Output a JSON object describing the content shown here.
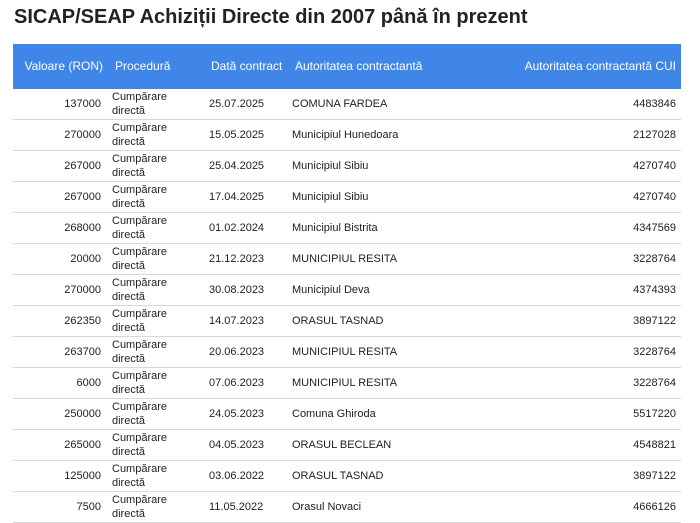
{
  "page": {
    "title": "SICAP/SEAP Achiziții Directe din 2007 până în prezent"
  },
  "table": {
    "headers": {
      "valoare": "Valoare (RON)",
      "procedura": "Procedură",
      "data": "Dată contract",
      "autoritatea": "Autoritatea contractantă",
      "cui": "Autoritatea contractantă CUI"
    },
    "rows": [
      {
        "valoare": "137000",
        "procedura": "Cumpărare directă",
        "data": "25.07.2025",
        "autoritatea": "COMUNA FARDEA",
        "cui": "4483846"
      },
      {
        "valoare": "270000",
        "procedura": "Cumpărare directă",
        "data": "15.05.2025",
        "autoritatea": "Municipiul Hunedoara",
        "cui": "2127028"
      },
      {
        "valoare": "267000",
        "procedura": "Cumpărare directă",
        "data": "25.04.2025",
        "autoritatea": "Municipiul Sibiu",
        "cui": "4270740"
      },
      {
        "valoare": "267000",
        "procedura": "Cumpărare directă",
        "data": "17.04.2025",
        "autoritatea": "Municipiul Sibiu",
        "cui": "4270740"
      },
      {
        "valoare": "268000",
        "procedura": "Cumpărare directă",
        "data": "01.02.2024",
        "autoritatea": "Municipiul Bistrita",
        "cui": "4347569"
      },
      {
        "valoare": "20000",
        "procedura": "Cumpărare directă",
        "data": "21.12.2023",
        "autoritatea": "MUNICIPIUL RESITA",
        "cui": "3228764"
      },
      {
        "valoare": "270000",
        "procedura": "Cumpărare directă",
        "data": "30.08.2023",
        "autoritatea": "Municipiul Deva",
        "cui": "4374393"
      },
      {
        "valoare": "262350",
        "procedura": "Cumpărare directă",
        "data": "14.07.2023",
        "autoritatea": "ORASUL TASNAD",
        "cui": "3897122"
      },
      {
        "valoare": "263700",
        "procedura": "Cumpărare directă",
        "data": "20.06.2023",
        "autoritatea": "MUNICIPIUL RESITA",
        "cui": "3228764"
      },
      {
        "valoare": "6000",
        "procedura": "Cumpărare directă",
        "data": "07.06.2023",
        "autoritatea": "MUNICIPIUL RESITA",
        "cui": "3228764"
      },
      {
        "valoare": "250000",
        "procedura": "Cumpărare directă",
        "data": "24.05.2023",
        "autoritatea": "Comuna Ghiroda",
        "cui": "5517220"
      },
      {
        "valoare": "265000",
        "procedura": "Cumpărare directă",
        "data": "04.05.2023",
        "autoritatea": "ORASUL BECLEAN",
        "cui": "4548821"
      },
      {
        "valoare": "125000",
        "procedura": "Cumpărare directă",
        "data": "03.06.2022",
        "autoritatea": "ORASUL TASNAD",
        "cui": "3897122"
      },
      {
        "valoare": "7500",
        "procedura": "Cumpărare directă",
        "data": "11.05.2022",
        "autoritatea": "Orasul Novaci",
        "cui": "4666126"
      }
    ]
  },
  "colors": {
    "header_bg": "#3f86e8",
    "header_text": "#ffffff",
    "row_border": "#d8d8d8"
  }
}
